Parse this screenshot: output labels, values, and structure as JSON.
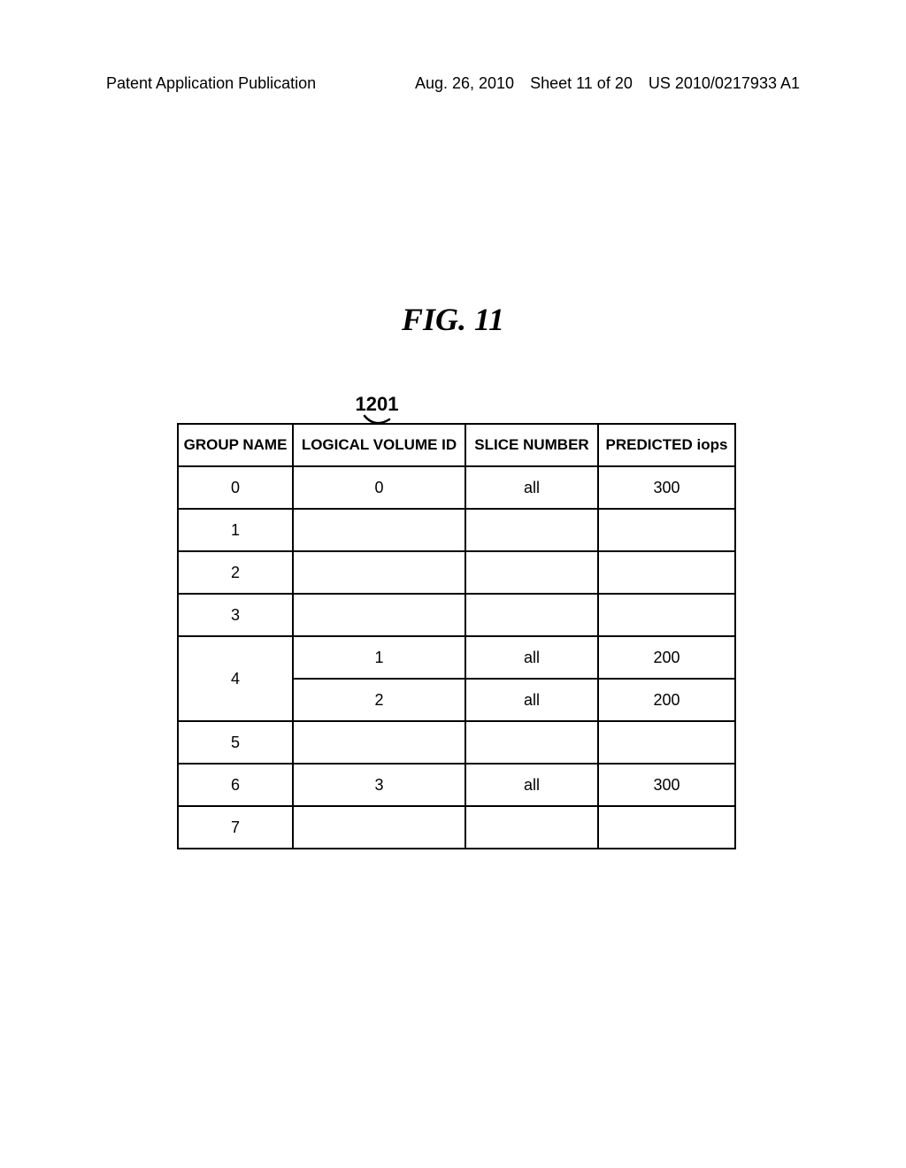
{
  "header": {
    "left": "Patent Application Publication",
    "date": "Aug. 26, 2010",
    "sheet": "Sheet 11 of 20",
    "pubno": "US 2010/0217933 A1"
  },
  "figure": {
    "title": "FIG. 11",
    "callout": "1201"
  },
  "table": {
    "headers": [
      "GROUP NAME",
      "LOGICAL VOLUME ID",
      "SLICE NUMBER",
      "PREDICTED iops"
    ],
    "rows": [
      {
        "group": "0",
        "sub": [
          {
            "vol": "0",
            "slice": "all",
            "iops": "300"
          }
        ]
      },
      {
        "group": "1",
        "sub": [
          {
            "vol": "",
            "slice": "",
            "iops": ""
          }
        ]
      },
      {
        "group": "2",
        "sub": [
          {
            "vol": "",
            "slice": "",
            "iops": ""
          }
        ]
      },
      {
        "group": "3",
        "sub": [
          {
            "vol": "",
            "slice": "",
            "iops": ""
          }
        ]
      },
      {
        "group": "4",
        "sub": [
          {
            "vol": "1",
            "slice": "all",
            "iops": "200"
          },
          {
            "vol": "2",
            "slice": "all",
            "iops": "200"
          }
        ]
      },
      {
        "group": "5",
        "sub": [
          {
            "vol": "",
            "slice": "",
            "iops": ""
          }
        ]
      },
      {
        "group": "6",
        "sub": [
          {
            "vol": "3",
            "slice": "all",
            "iops": "300"
          }
        ]
      },
      {
        "group": "7",
        "sub": [
          {
            "vol": "",
            "slice": "",
            "iops": ""
          }
        ]
      }
    ]
  }
}
